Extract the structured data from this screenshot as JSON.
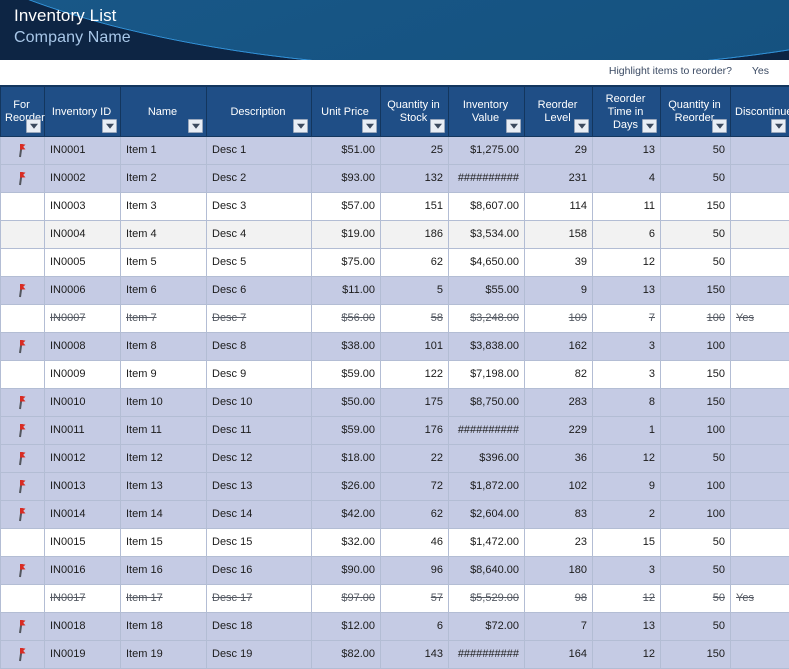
{
  "banner": {
    "title": "Inventory List",
    "subtitle": "Company Name"
  },
  "options": {
    "highlight_label": "Highlight items to reorder?",
    "highlight_value": "Yes"
  },
  "table": {
    "columns": [
      {
        "label": "For Reorder",
        "key": "for_reorder",
        "align": "center"
      },
      {
        "label": "Inventory ID",
        "key": "inventory_id",
        "align": "left"
      },
      {
        "label": "Name",
        "key": "name",
        "align": "left"
      },
      {
        "label": "Description",
        "key": "description",
        "align": "left"
      },
      {
        "label": "Unit Price",
        "key": "unit_price",
        "align": "right"
      },
      {
        "label": "Quantity in Stock",
        "key": "quantity_in_stock",
        "align": "right"
      },
      {
        "label": "Inventory Value",
        "key": "inventory_value",
        "align": "right"
      },
      {
        "label": "Reorder Level",
        "key": "reorder_level",
        "align": "right"
      },
      {
        "label": "Reorder Time in Days",
        "key": "reorder_time_days",
        "align": "right"
      },
      {
        "label": "Quantity in Reorder",
        "key": "quantity_in_reorder",
        "align": "right"
      },
      {
        "label": "Discontinued?",
        "key": "discontinued",
        "align": "left"
      }
    ],
    "filter_icon": "filter-dropdown-icon",
    "flag_icon": "red-flag-icon",
    "rows": [
      {
        "for_reorder": true,
        "inventory_id": "IN0001",
        "name": "Item 1",
        "description": "Desc 1",
        "unit_price": "$51.00",
        "quantity_in_stock": "25",
        "inventory_value": "$1,275.00",
        "reorder_level": "29",
        "reorder_time_days": "13",
        "quantity_in_reorder": "50",
        "discontinued": "",
        "style": "flag"
      },
      {
        "for_reorder": true,
        "inventory_id": "IN0002",
        "name": "Item 2",
        "description": "Desc 2",
        "unit_price": "$93.00",
        "quantity_in_stock": "132",
        "inventory_value": "##########",
        "reorder_level": "231",
        "reorder_time_days": "4",
        "quantity_in_reorder": "50",
        "discontinued": "",
        "style": "flag"
      },
      {
        "for_reorder": false,
        "inventory_id": "IN0003",
        "name": "Item 3",
        "description": "Desc 3",
        "unit_price": "$57.00",
        "quantity_in_stock": "151",
        "inventory_value": "$8,607.00",
        "reorder_level": "114",
        "reorder_time_days": "11",
        "quantity_in_reorder": "150",
        "discontinued": "",
        "style": "white"
      },
      {
        "for_reorder": false,
        "inventory_id": "IN0004",
        "name": "Item 4",
        "description": "Desc 4",
        "unit_price": "$19.00",
        "quantity_in_stock": "186",
        "inventory_value": "$3,534.00",
        "reorder_level": "158",
        "reorder_time_days": "6",
        "quantity_in_reorder": "50",
        "discontinued": "",
        "style": "gray"
      },
      {
        "for_reorder": false,
        "inventory_id": "IN0005",
        "name": "Item 5",
        "description": "Desc 5",
        "unit_price": "$75.00",
        "quantity_in_stock": "62",
        "inventory_value": "$4,650.00",
        "reorder_level": "39",
        "reorder_time_days": "12",
        "quantity_in_reorder": "50",
        "discontinued": "",
        "style": "white"
      },
      {
        "for_reorder": true,
        "inventory_id": "IN0006",
        "name": "Item 6",
        "description": "Desc 6",
        "unit_price": "$11.00",
        "quantity_in_stock": "5",
        "inventory_value": "$55.00",
        "reorder_level": "9",
        "reorder_time_days": "13",
        "quantity_in_reorder": "150",
        "discontinued": "",
        "style": "flag"
      },
      {
        "for_reorder": false,
        "inventory_id": "IN0007",
        "name": "Item 7",
        "description": "Desc 7",
        "unit_price": "$56.00",
        "quantity_in_stock": "58",
        "inventory_value": "$3,248.00",
        "reorder_level": "109",
        "reorder_time_days": "7",
        "quantity_in_reorder": "100",
        "discontinued": "Yes",
        "style": "white",
        "discontinued_row": true
      },
      {
        "for_reorder": true,
        "inventory_id": "IN0008",
        "name": "Item 8",
        "description": "Desc 8",
        "unit_price": "$38.00",
        "quantity_in_stock": "101",
        "inventory_value": "$3,838.00",
        "reorder_level": "162",
        "reorder_time_days": "3",
        "quantity_in_reorder": "100",
        "discontinued": "",
        "style": "flag"
      },
      {
        "for_reorder": false,
        "inventory_id": "IN0009",
        "name": "Item 9",
        "description": "Desc 9",
        "unit_price": "$59.00",
        "quantity_in_stock": "122",
        "inventory_value": "$7,198.00",
        "reorder_level": "82",
        "reorder_time_days": "3",
        "quantity_in_reorder": "150",
        "discontinued": "",
        "style": "white"
      },
      {
        "for_reorder": true,
        "inventory_id": "IN0010",
        "name": "Item 10",
        "description": "Desc 10",
        "unit_price": "$50.00",
        "quantity_in_stock": "175",
        "inventory_value": "$8,750.00",
        "reorder_level": "283",
        "reorder_time_days": "8",
        "quantity_in_reorder": "150",
        "discontinued": "",
        "style": "flag"
      },
      {
        "for_reorder": true,
        "inventory_id": "IN0011",
        "name": "Item 11",
        "description": "Desc 11",
        "unit_price": "$59.00",
        "quantity_in_stock": "176",
        "inventory_value": "##########",
        "reorder_level": "229",
        "reorder_time_days": "1",
        "quantity_in_reorder": "100",
        "discontinued": "",
        "style": "flag"
      },
      {
        "for_reorder": true,
        "inventory_id": "IN0012",
        "name": "Item 12",
        "description": "Desc 12",
        "unit_price": "$18.00",
        "quantity_in_stock": "22",
        "inventory_value": "$396.00",
        "reorder_level": "36",
        "reorder_time_days": "12",
        "quantity_in_reorder": "50",
        "discontinued": "",
        "style": "flag"
      },
      {
        "for_reorder": true,
        "inventory_id": "IN0013",
        "name": "Item 13",
        "description": "Desc 13",
        "unit_price": "$26.00",
        "quantity_in_stock": "72",
        "inventory_value": "$1,872.00",
        "reorder_level": "102",
        "reorder_time_days": "9",
        "quantity_in_reorder": "100",
        "discontinued": "",
        "style": "flag"
      },
      {
        "for_reorder": true,
        "inventory_id": "IN0014",
        "name": "Item 14",
        "description": "Desc 14",
        "unit_price": "$42.00",
        "quantity_in_stock": "62",
        "inventory_value": "$2,604.00",
        "reorder_level": "83",
        "reorder_time_days": "2",
        "quantity_in_reorder": "100",
        "discontinued": "",
        "style": "flag"
      },
      {
        "for_reorder": false,
        "inventory_id": "IN0015",
        "name": "Item 15",
        "description": "Desc 15",
        "unit_price": "$32.00",
        "quantity_in_stock": "46",
        "inventory_value": "$1,472.00",
        "reorder_level": "23",
        "reorder_time_days": "15",
        "quantity_in_reorder": "50",
        "discontinued": "",
        "style": "white"
      },
      {
        "for_reorder": true,
        "inventory_id": "IN0016",
        "name": "Item 16",
        "description": "Desc 16",
        "unit_price": "$90.00",
        "quantity_in_stock": "96",
        "inventory_value": "$8,640.00",
        "reorder_level": "180",
        "reorder_time_days": "3",
        "quantity_in_reorder": "50",
        "discontinued": "",
        "style": "flag"
      },
      {
        "for_reorder": false,
        "inventory_id": "IN0017",
        "name": "Item 17",
        "description": "Desc 17",
        "unit_price": "$97.00",
        "quantity_in_stock": "57",
        "inventory_value": "$5,529.00",
        "reorder_level": "98",
        "reorder_time_days": "12",
        "quantity_in_reorder": "50",
        "discontinued": "Yes",
        "style": "white",
        "discontinued_row": true
      },
      {
        "for_reorder": true,
        "inventory_id": "IN0018",
        "name": "Item 18",
        "description": "Desc 18",
        "unit_price": "$12.00",
        "quantity_in_stock": "6",
        "inventory_value": "$72.00",
        "reorder_level": "7",
        "reorder_time_days": "13",
        "quantity_in_reorder": "50",
        "discontinued": "",
        "style": "flag"
      },
      {
        "for_reorder": true,
        "inventory_id": "IN0019",
        "name": "Item 19",
        "description": "Desc 19",
        "unit_price": "$82.00",
        "quantity_in_stock": "143",
        "inventory_value": "##########",
        "reorder_level": "164",
        "reorder_time_days": "12",
        "quantity_in_reorder": "150",
        "discontinued": "",
        "style": "flag"
      }
    ]
  },
  "colors": {
    "banner_dark": "#0d2544",
    "banner_arc": "#185787",
    "header_blue": "#1f4e86",
    "row_highlight": "#c5cbe4",
    "row_alt": "#f2f2f2",
    "flag_red": "#d92b22",
    "grid_line": "#b3bdd4"
  }
}
